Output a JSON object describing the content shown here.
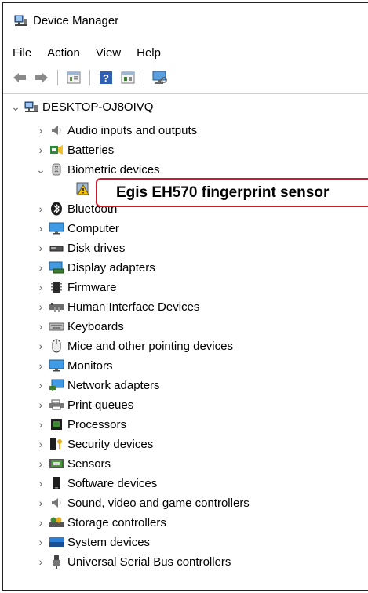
{
  "window": {
    "title": "Device Manager"
  },
  "menu": [
    "File",
    "Action",
    "View",
    "Help"
  ],
  "toolbar": [
    "back-arrow-icon",
    "forward-arrow-icon",
    "properties-icon",
    "help-icon",
    "update-driver-icon",
    "scan-hardware-icon"
  ],
  "tree": {
    "root": "DESKTOP-OJ8OIVQ",
    "items": [
      {
        "label": "Audio inputs and outputs",
        "icon": "speaker-icon"
      },
      {
        "label": "Batteries",
        "icon": "battery-icon"
      },
      {
        "label": "Biometric devices",
        "icon": "biometric-icon",
        "expanded": true
      },
      {
        "label": "Bluetooth",
        "icon": "bluetooth-icon"
      },
      {
        "label": "Computer",
        "icon": "computer-icon"
      },
      {
        "label": "Disk drives",
        "icon": "disk-icon"
      },
      {
        "label": "Display adapters",
        "icon": "display-icon"
      },
      {
        "label": "Firmware",
        "icon": "firmware-icon"
      },
      {
        "label": "Human Interface Devices",
        "icon": "hid-icon"
      },
      {
        "label": "Keyboards",
        "icon": "keyboard-icon"
      },
      {
        "label": "Mice and other pointing devices",
        "icon": "mouse-icon"
      },
      {
        "label": "Monitors",
        "icon": "monitor-icon"
      },
      {
        "label": "Network adapters",
        "icon": "network-icon"
      },
      {
        "label": "Print queues",
        "icon": "printer-icon"
      },
      {
        "label": "Processors",
        "icon": "processor-icon"
      },
      {
        "label": "Security devices",
        "icon": "security-icon"
      },
      {
        "label": "Sensors",
        "icon": "sensor-icon"
      },
      {
        "label": "Software devices",
        "icon": "software-icon"
      },
      {
        "label": "Sound, video and game controllers",
        "icon": "sound-icon"
      },
      {
        "label": "Storage controllers",
        "icon": "storage-icon"
      },
      {
        "label": "System devices",
        "icon": "system-icon"
      },
      {
        "label": "Universal Serial Bus controllers",
        "icon": "usb-icon"
      }
    ],
    "child": {
      "label": "Egis EH570 fingerprint sensor",
      "icon": "warning-device-icon"
    }
  },
  "colors": {
    "callout_border": "#c81b2b",
    "chevron": "#666666"
  }
}
